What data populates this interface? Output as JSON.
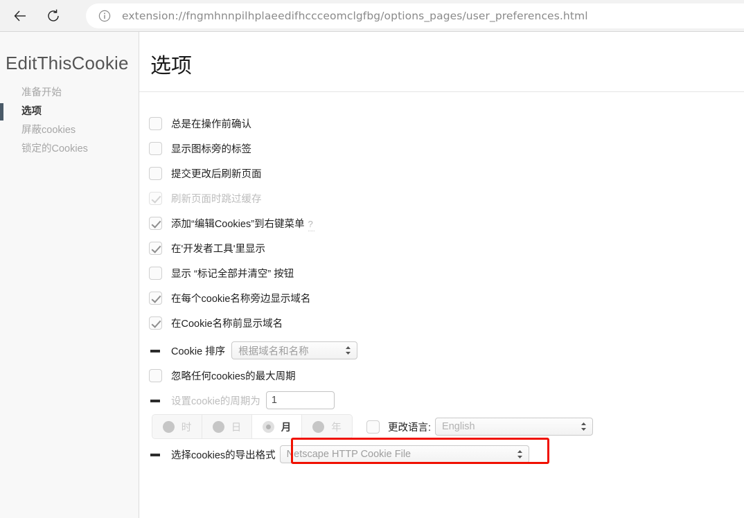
{
  "browser": {
    "back_icon": "back-arrow-icon",
    "reload_icon": "reload-icon",
    "info_icon": "page-info-icon",
    "url_scheme": "extension://",
    "url_host": "fngmhnnpilhplaeedifhccceomclgfbg",
    "url_path": "/options_pages/user_preferences.html",
    "url_full": "extension://fngmhnnpilhplaeedifhccceomclgfbg/options_pages/user_preferences.html"
  },
  "sidebar": {
    "brand": "EditThisCookie",
    "items": [
      {
        "label": "准备开始",
        "active": false
      },
      {
        "label": "选项",
        "active": true
      },
      {
        "label": "屏蔽cookies",
        "active": false
      },
      {
        "label": "锁定的Cookies",
        "active": false
      }
    ]
  },
  "main": {
    "title": "选项",
    "checkboxes": [
      {
        "label": "总是在操作前确认",
        "checked": false,
        "disabled": false
      },
      {
        "label": "显示图标旁的标签",
        "checked": false,
        "disabled": false
      },
      {
        "label": "提交更改后刷新页面",
        "checked": false,
        "disabled": false
      },
      {
        "label": "刷新页面时跳过缓存",
        "checked": true,
        "disabled": true
      },
      {
        "label": "添加“编辑Cookies”到右键菜单",
        "checked": true,
        "disabled": false,
        "help": "?"
      },
      {
        "label": "在'开发者工具'里显示",
        "checked": true,
        "disabled": false
      },
      {
        "label": "显示 “标记全部并清空” 按钮",
        "checked": false,
        "disabled": false
      },
      {
        "label": "在每个cookie名称旁边显示域名",
        "checked": true,
        "disabled": false
      },
      {
        "label": "在Cookie名称前显示域名",
        "checked": true,
        "disabled": false
      }
    ],
    "sort": {
      "label": "Cookie 排序",
      "value": "根据域名和名称",
      "options": [
        "根据域名和名称"
      ]
    },
    "ignore_max_age": {
      "label": "忽略任何cookies的最大周期",
      "checked": false
    },
    "period": {
      "label": "设置cookie的周期为",
      "value": "1",
      "units": [
        {
          "label": "时",
          "selected": false
        },
        {
          "label": "日",
          "selected": false
        },
        {
          "label": "月",
          "selected": true
        },
        {
          "label": "年",
          "selected": false
        }
      ]
    },
    "language": {
      "checked": false,
      "label": "更改语言:",
      "value": "English",
      "options": [
        "English"
      ]
    },
    "export": {
      "label": "选择cookies的导出格式",
      "value": "Netscape HTTP Cookie File",
      "options": [
        "Netscape HTTP Cookie File"
      ],
      "highlight_color": "#f01000"
    }
  }
}
